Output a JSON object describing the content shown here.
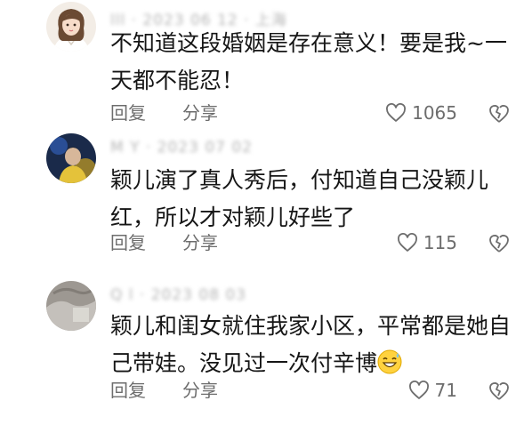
{
  "comments": [
    {
      "meta": "lll · 2023 06 12 · 上海",
      "text": "不知道这段婚姻是存在意义！要是我~一天都不能忍！",
      "reply_label": "回复",
      "share_label": "分享",
      "likes": "1065",
      "avatar_icon": "woman-portrait-avatar"
    },
    {
      "meta": "M  Y  · 2023 07 02",
      "text": "颖儿演了真人秀后，付知道自己没颖儿红，所以才对颖儿好些了",
      "reply_label": "回复",
      "share_label": "分享",
      "likes": "115",
      "avatar_icon": "performer-photo-avatar"
    },
    {
      "meta": "Q l · 2023 08 03",
      "text": "颖儿和闺女就住我家小区，平常都是她自己带娃。没见过一次付辛博",
      "reply_label": "回复",
      "share_label": "分享",
      "likes": "71",
      "avatar_icon": "grey-photo-avatar",
      "trailing_emoji": "grinning-sweat-emoji"
    }
  ],
  "colors": {
    "text": "#161616",
    "secondary": "#6d6d6d",
    "meta_blurred": "#b5b5b5"
  }
}
